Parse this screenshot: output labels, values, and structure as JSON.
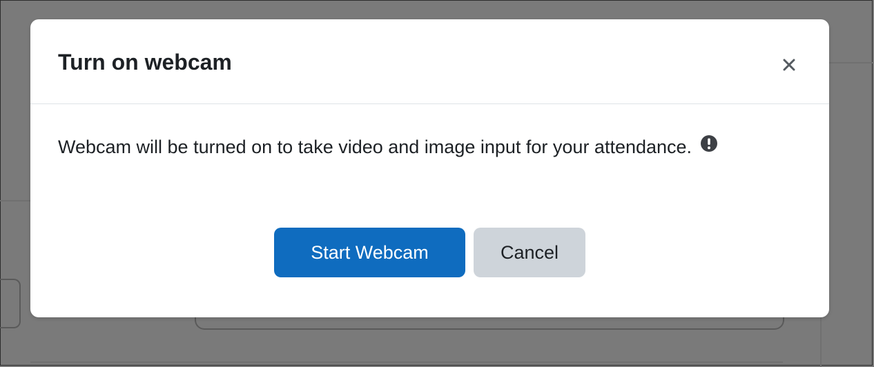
{
  "modal": {
    "title": "Turn on webcam",
    "close_icon": "close-icon",
    "body_text": "Webcam will be turned on to take video and image input for your attendance.",
    "info_icon": "exclamation-circle-icon",
    "buttons": {
      "start_label": "Start Webcam",
      "cancel_label": "Cancel"
    }
  },
  "colors": {
    "overlay": "#7a7a7a",
    "primary": "#0f6cbf",
    "secondary": "#ced4da",
    "text": "#1d2125"
  }
}
